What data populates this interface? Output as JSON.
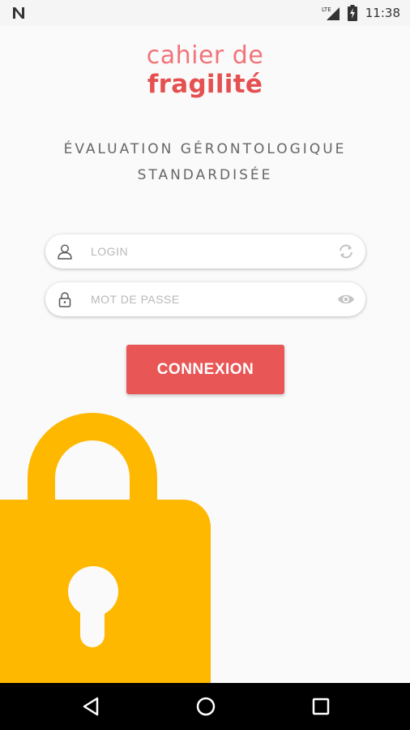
{
  "status_bar": {
    "network_label": "LTE",
    "time": "11:38"
  },
  "brand": {
    "line1": "cahier de",
    "line2": "fragilité"
  },
  "subtitle": {
    "line1": "ÉVALUATION GÉRONTOLOGIQUE",
    "line2": "STANDARDISÉE"
  },
  "login": {
    "placeholder": "LOGIN",
    "value": "",
    "lead_icon": "user-icon",
    "trail_icon": "refresh-icon"
  },
  "password": {
    "placeholder": "MOT DE PASSE",
    "value": "",
    "lead_icon": "lock-icon",
    "trail_icon": "eye-icon"
  },
  "connect_button": {
    "label": "CONNEXION"
  },
  "colors": {
    "accent": "#e85656",
    "brand_light": "#f0747a",
    "lock_illustration": "#ffb800",
    "nav_bar": "#000000"
  },
  "nav_bar": {
    "buttons": [
      "back-icon",
      "home-icon",
      "recents-icon"
    ]
  }
}
